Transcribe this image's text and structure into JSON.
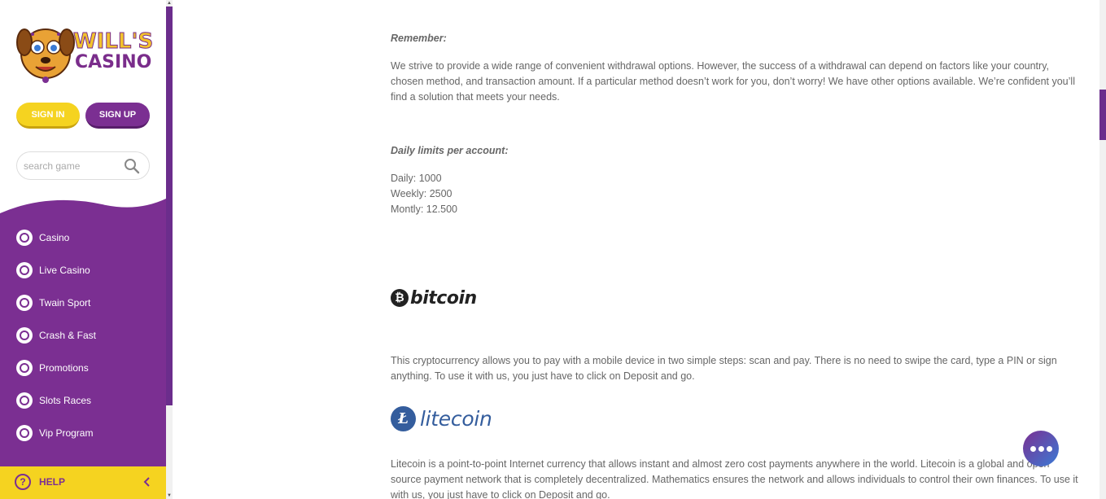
{
  "logo": {
    "line1": "WILL'S",
    "line2": "CASINO"
  },
  "auth": {
    "signin_label": "SIGN IN",
    "signup_label": "SIGN UP"
  },
  "search": {
    "placeholder": "search game"
  },
  "menu": {
    "items": [
      {
        "label": "Casino",
        "icon": "casino-chip-icon"
      },
      {
        "label": "Live Casino",
        "icon": "roulette-icon"
      },
      {
        "label": "Twain Sport",
        "icon": "ball-icon"
      },
      {
        "label": "Crash & Fast",
        "icon": "rocket-icon"
      },
      {
        "label": "Promotions",
        "icon": "gift-icon"
      },
      {
        "label": "Slots Races",
        "icon": "trophy-icon"
      },
      {
        "label": "Vip Program",
        "icon": "crown-icon"
      }
    ]
  },
  "help": {
    "label": "HELP"
  },
  "content": {
    "remember_heading": "Remember:",
    "remember_text": "We strive to provide a wide range of convenient withdrawal options. However, the success of a withdrawal can depend on factors like your country, chosen method, and transaction amount. If a particular method doesn’t work for you, don’t worry! We have other options available. We’re confident you’ll find a solution that meets your needs.",
    "limits_heading": "Daily limits per account:",
    "limit_daily": "Daily: 1000",
    "limit_weekly": "Weekly: 2500",
    "limit_monthly": "Montly: 12.500",
    "bitcoin_word": "bitcoin",
    "bitcoin_symbol": "₿",
    "bitcoin_text": "This cryptocurrency allows you to pay with a mobile device in two simple steps: scan and pay. There is no need to swipe the card, type a PIN or sign anything. To use it with us, you just have to click on Deposit and go.",
    "litecoin_word": "litecoin",
    "litecoin_symbol": "Ł",
    "litecoin_text": "Litecoin is a point-to-point Internet currency that allows instant and almost zero cost payments anywhere in the world. Litecoin is a global and open source payment network that is completely decentralized. Mathematics ensures the network and allows individuals to control their own finances. To use it with us, you just have to click on Deposit and go."
  },
  "colors": {
    "brand_purple": "#7b2f92",
    "brand_yellow": "#f5d320",
    "text_gray": "#666666",
    "litecoin_blue": "#345d9d"
  }
}
